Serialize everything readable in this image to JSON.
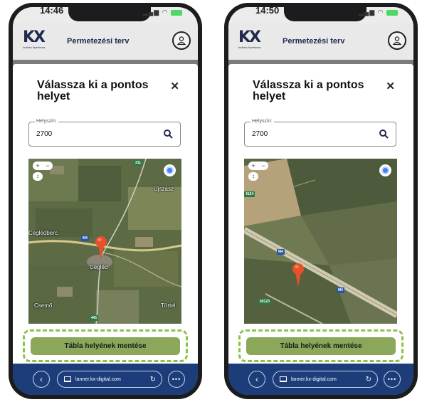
{
  "screens": [
    {
      "status": {
        "time": "14:46"
      },
      "header": {
        "logo_text": "KX",
        "logo_sub": "Invitalo Nyerleraa",
        "title": "Permetezési terv"
      },
      "modal": {
        "title": "Válassza ki a pontos helyet",
        "field_label": "Helyszín:",
        "field_value": "2700",
        "map": {
          "zoom_in": "+",
          "zoom_out": "−",
          "zoom_extra": "↕",
          "labels": {
            "town1": "Cegléd",
            "town2": "Újszász",
            "town3": "Csemő",
            "town4": "Törtel",
            "town5": "Ceglédberc."
          },
          "roads": {
            "r1": "311",
            "r2": "M4",
            "r3": "441"
          }
        },
        "save_label": "Tábla helyének mentése"
      },
      "browser": {
        "url": "lanner.kx-digital.com",
        "back": "‹",
        "reload": "↻",
        "more": "•••"
      }
    },
    {
      "status": {
        "time": "14:50"
      },
      "header": {
        "logo_text": "KX",
        "logo_sub": "Invitalo Nyerleraa",
        "title": "Permetezési terv"
      },
      "modal": {
        "title": "Válassza ki a pontos helyet",
        "field_label": "Helyszín:",
        "field_value": "2700",
        "map": {
          "zoom_in": "+",
          "zoom_out": "−",
          "zoom_extra": "↕",
          "roads": {
            "r1": "4124",
            "r2": "M4",
            "r3": "M4",
            "r4": "40123"
          }
        },
        "save_label": "Tábla helyének mentése"
      },
      "browser": {
        "url": "lanner.kx-digital.com",
        "back": "‹",
        "reload": "↻",
        "more": "•••"
      }
    }
  ],
  "colors": {
    "accent_button": "#8aa75a",
    "highlight_dashed": "#8bc34a",
    "browser_bar": "#1d3d7a",
    "pin": "#e8502a",
    "brand": "#1f2a4c"
  },
  "icons": [
    "search-icon",
    "close-icon",
    "user-icon",
    "locate-icon",
    "map-pin-icon",
    "back-icon",
    "tab-icon",
    "reload-icon",
    "more-icon"
  ]
}
